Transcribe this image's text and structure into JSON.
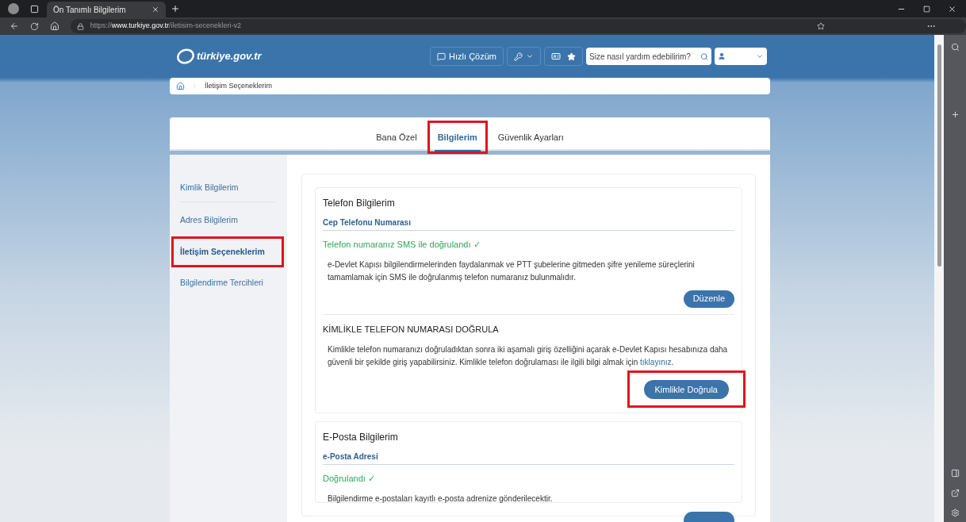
{
  "browser": {
    "tab_title": "Ön Tanımlı Bilgilerim",
    "url_prefix": "https://",
    "url_host": "www.turkiye.gov.tr",
    "url_path": "/iletisim-secenekleri-v2"
  },
  "header": {
    "logo": "türkiye.gov.tr",
    "quick_button": "Hızlı Çözüm",
    "search": {
      "placeholder": "Size nasıl yardım edebilirim?"
    }
  },
  "breadcrumb": [
    "İletişim Seçeneklerim"
  ],
  "tabs": [
    {
      "label": "Bana Özel",
      "selected": false,
      "highlighted": false
    },
    {
      "label": "Bilgilerim",
      "selected": true,
      "highlighted": true
    },
    {
      "label": "Güvenlik Ayarları",
      "selected": false,
      "highlighted": false
    }
  ],
  "sidebar": {
    "items": [
      {
        "label": "Kimlik Bilgilerim",
        "selected": false,
        "highlighted": false
      },
      {
        "label": "Adres Bilgilerim",
        "selected": false,
        "highlighted": false
      },
      {
        "label": "İletişim Seçeneklerim",
        "selected": true,
        "highlighted": true
      },
      {
        "label": "Bilgilendirme Tercihleri",
        "selected": false,
        "highlighted": false
      }
    ]
  },
  "sections": [
    {
      "title": "Telefon Bilgilerim",
      "subtitle": "Cep Telefonu Numarası",
      "status": "Telefon numaranız SMS ile doğrulandı ✓",
      "text": "e-Devlet Kapısı bilgilendirmelerinden faydalanmak ve PTT şubelerine gitmeden şifre yenileme süreçlerini tamamlamak için SMS ile doğrulanmış telefon numaranız bulunmalıdır.",
      "button": "Düzenle",
      "sub": {
        "title": "KİMLİKLE TELEFON NUMARASI DOĞRULA",
        "text": "Kimlikle telefon numaranızı doğruladıktan sonra iki aşamalı giriş özelliğini açarak e-Devlet Kapısı hesabınıza daha güvenli bir şekilde giriş yapabilirsiniz. Kimlikle telefon doğrulaması ile ilgili bilgi almak için",
        "link": "tıklayınız",
        "after": ".",
        "button": "Kimlikle Doğrula",
        "button_highlighted": true
      }
    },
    {
      "title": "E-Posta Bilgilerim",
      "subtitle": "e-Posta Adresi",
      "status": "Doğrulandı ✓",
      "text": "Bilgilendirme e-postaları kayıtlı e-posta adrenize gönderilecektir."
    }
  ]
}
